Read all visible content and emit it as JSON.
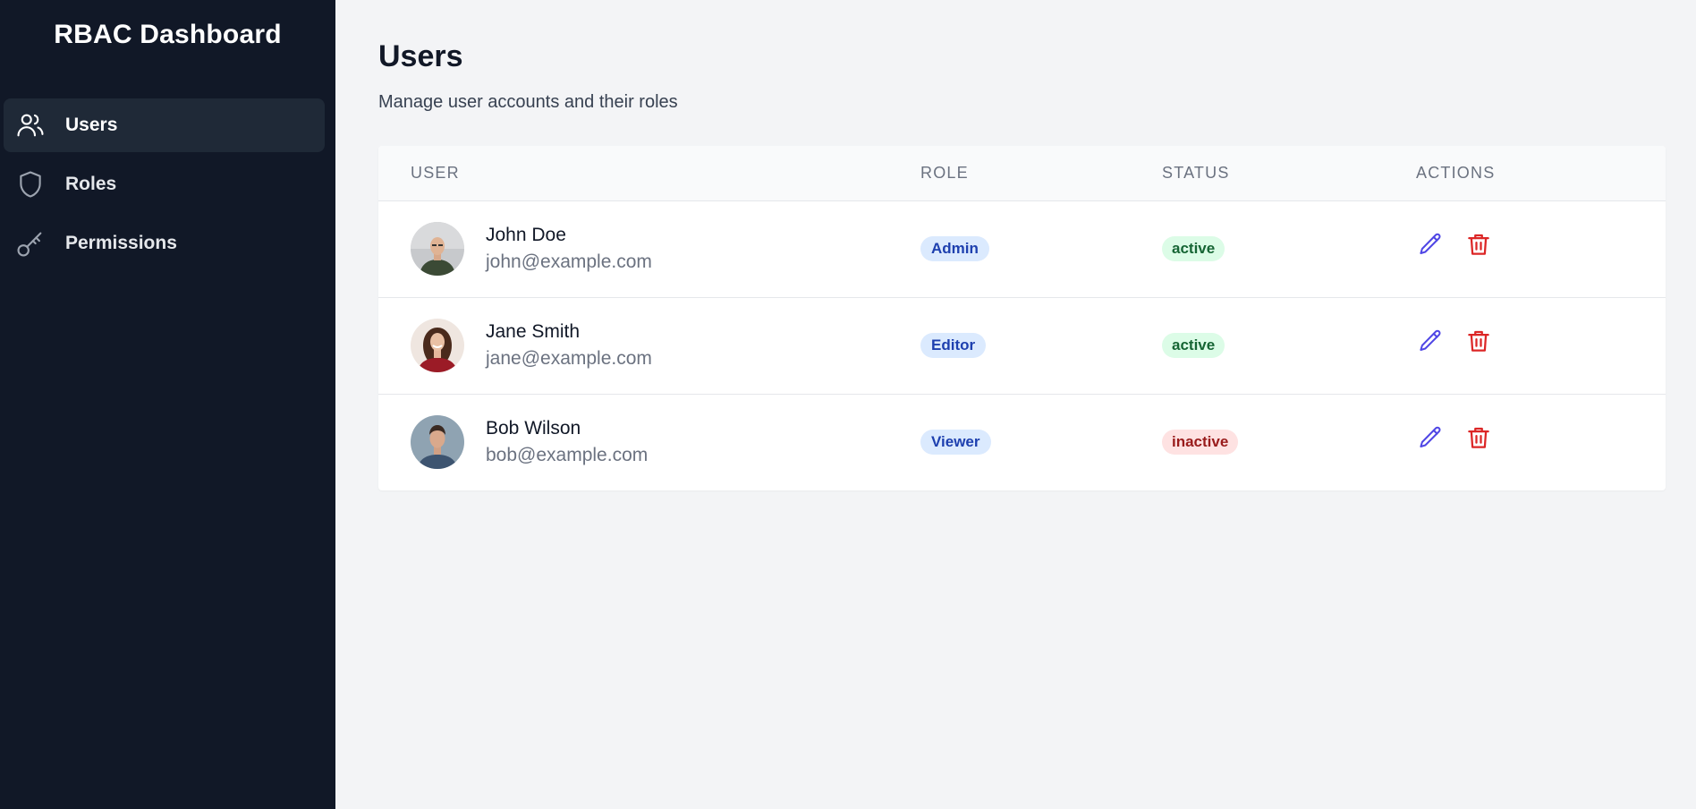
{
  "sidebar": {
    "title": "RBAC Dashboard",
    "items": [
      {
        "label": "Users",
        "icon": "users-icon",
        "active": true
      },
      {
        "label": "Roles",
        "icon": "shield-icon",
        "active": false
      },
      {
        "label": "Permissions",
        "icon": "key-icon",
        "active": false
      }
    ]
  },
  "main": {
    "title": "Users",
    "subtitle": "Manage user accounts and their roles"
  },
  "table": {
    "headers": [
      "USER",
      "ROLE",
      "STATUS",
      "ACTIONS"
    ],
    "rows": [
      {
        "name": "John Doe",
        "email": "john@example.com",
        "role": "Admin",
        "status": "active"
      },
      {
        "name": "Jane Smith",
        "email": "jane@example.com",
        "role": "Editor",
        "status": "active"
      },
      {
        "name": "Bob Wilson",
        "email": "bob@example.com",
        "role": "Viewer",
        "status": "inactive"
      }
    ]
  },
  "colors": {
    "sidebar_bg": "#111827",
    "sidebar_active_bg": "#1f2937",
    "page_bg": "#f3f4f6",
    "role_badge_bg": "#dbeafe",
    "role_badge_text": "#1e40af",
    "status_active_bg": "#dcfce7",
    "status_active_text": "#166534",
    "status_inactive_bg": "#fee2e2",
    "status_inactive_text": "#991b1b",
    "edit_icon": "#4f46e5",
    "delete_icon": "#dc2626"
  }
}
